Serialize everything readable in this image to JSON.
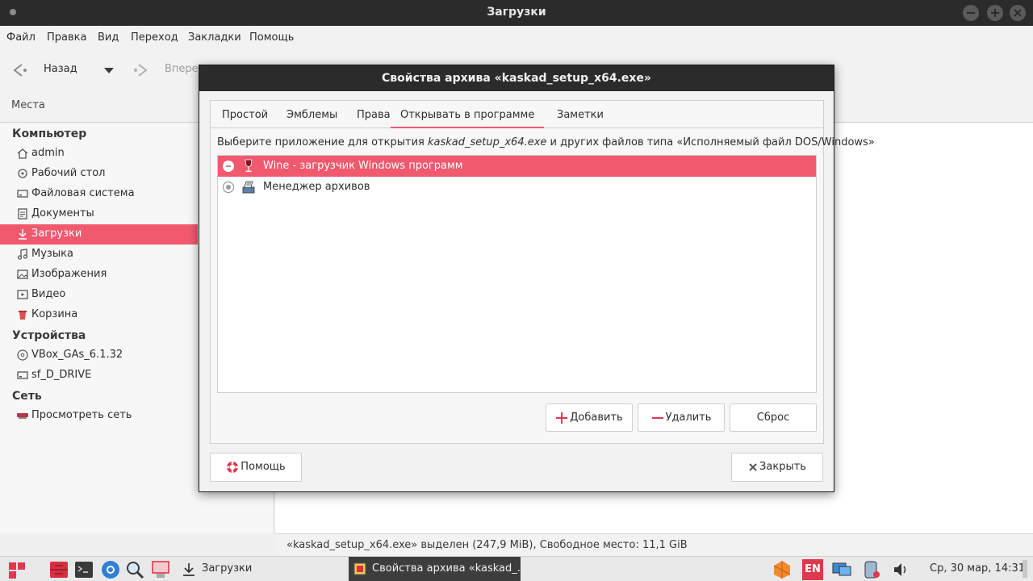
{
  "window": {
    "title": "Загрузки",
    "menu": [
      "Файл",
      "Правка",
      "Вид",
      "Переход",
      "Закладки",
      "Помощь"
    ]
  },
  "toolbar": {
    "back_label": "Назад",
    "forward_label": "Впере"
  },
  "places_header": "Места",
  "sidebar": {
    "sections": [
      {
        "title": "Компьютер"
      },
      {
        "title": "Устройства"
      },
      {
        "title": "Сеть"
      }
    ],
    "computer_items": [
      {
        "label": "admin",
        "icon": "home-icon"
      },
      {
        "label": "Рабочий стол",
        "icon": "desktop-icon"
      },
      {
        "label": "Файловая система",
        "icon": "drive-icon"
      },
      {
        "label": "Документы",
        "icon": "document-icon"
      },
      {
        "label": "Загрузки",
        "icon": "download-icon",
        "active": true
      },
      {
        "label": "Музыка",
        "icon": "music-icon"
      },
      {
        "label": "Изображения",
        "icon": "image-icon"
      },
      {
        "label": "Видео",
        "icon": "video-icon"
      },
      {
        "label": "Корзина",
        "icon": "trash-icon"
      }
    ],
    "device_items": [
      {
        "label": "VBox_GAs_6.1.32",
        "icon": "disc-icon"
      },
      {
        "label": "sf_D_DRIVE",
        "icon": "drive-icon"
      }
    ],
    "network_items": [
      {
        "label": "Просмотреть сеть",
        "icon": "network-icon"
      }
    ]
  },
  "statusbar": {
    "text": "«kaskad_setup_x64.exe» выделен (247,9 MiB), Свободное место: 11,1 GiB"
  },
  "dialog": {
    "title": "Свойства архива «kaskad_setup_x64.exe»",
    "tabs": [
      "Простой",
      "Эмблемы",
      "Права",
      "Открывать в программе",
      "Заметки"
    ],
    "active_tab": "Открывать в программе",
    "description_prefix": "Выберите приложение для открытия ",
    "description_file": "kaskad_setup_x64.exe",
    "description_suffix": " и других файлов типа «Исполняемый файл DOS/Windows»",
    "apps": [
      {
        "label": "Wine - загрузчик Windows программ",
        "icon": "wine-glass-icon",
        "selected": true
      },
      {
        "label": "Менеджер архивов",
        "icon": "archive-manager-icon",
        "selected": false
      }
    ],
    "add_label": "Добавить",
    "remove_label": "Удалить",
    "reset_label": "Сброс",
    "help_label": "Помощь",
    "close_label": "Закрыть"
  },
  "panel": {
    "task_downloads": "Загрузки",
    "task_dialog": "Свойства архива «kaskad_...",
    "keyboard_layout": "EN",
    "clock": "Ср, 30 мар, 14:31"
  },
  "colors": {
    "accent": "#f0596e",
    "titlebar": "#2b2b2b"
  }
}
